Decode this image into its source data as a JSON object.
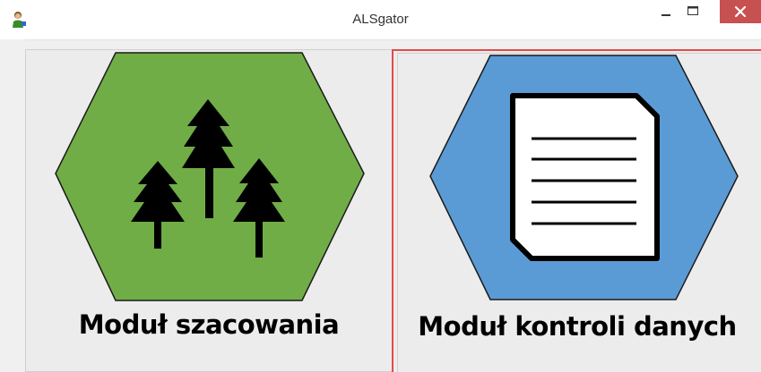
{
  "window": {
    "title": "ALSgator",
    "app_icon": "person-icon"
  },
  "controls": {
    "minimize_icon": "minimize-icon",
    "maximize_icon": "maximize-icon",
    "close_icon": "close-icon",
    "close_color": "#c75050"
  },
  "modules": [
    {
      "label": "Moduł szacowania",
      "icon": "trees-icon",
      "hex_color": "#70ad47"
    },
    {
      "label": "Moduł kontroli danych",
      "icon": "document-icon",
      "hex_color": "#5b9bd5",
      "selected": true,
      "focus_color": "#e04b4b"
    }
  ]
}
